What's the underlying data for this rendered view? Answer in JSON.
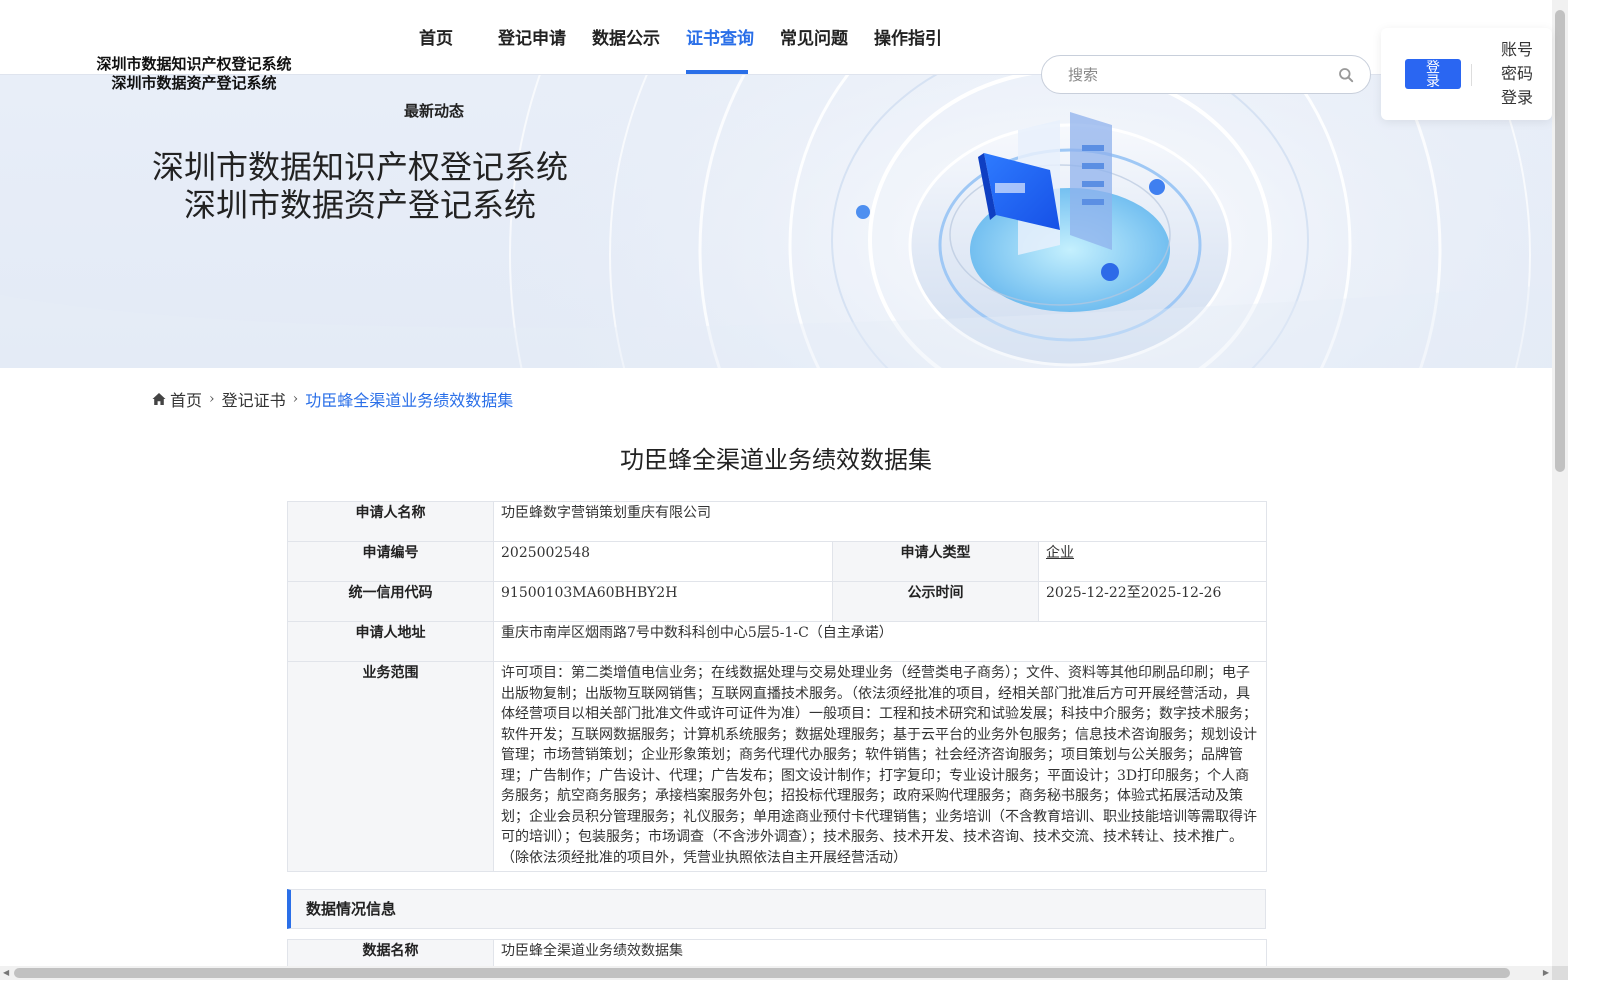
{
  "header": {
    "logo_line1": "深圳市数据知识产权登记系统",
    "logo_line2": "深圳市数据资产登记系统",
    "nav": [
      {
        "label": "首页"
      },
      {
        "label": "登记申请"
      },
      {
        "label": "数据公示"
      },
      {
        "label": "证书查询"
      },
      {
        "label": "常见问题"
      },
      {
        "label": "操作指引"
      }
    ],
    "nav_active": "证书查询",
    "nav_sub": "最新动态",
    "search_placeholder": "搜索",
    "login_label": "登录",
    "password_login_label": "账号密码登录",
    "accent_color": "#2a6fe8"
  },
  "banner": {
    "title_line1": "深圳市数据知识产权登记系统",
    "title_line2": "深圳市数据资产登记系统"
  },
  "breadcrumb": {
    "home": "首页",
    "level1": "登记证书",
    "current": "功臣蜂全渠道业务绩效数据集"
  },
  "page_title": "功臣蜂全渠道业务绩效数据集",
  "info": {
    "applicant_name_label": "申请人名称",
    "applicant_name": "功臣蜂数字营销策划重庆有限公司",
    "app_no_label": "申请编号",
    "app_no": "2025002548",
    "applicant_type_label": "申请人类型",
    "applicant_type": "企业",
    "credit_code_label": "统一信用代码",
    "credit_code": "91500103MA60BHBY2H",
    "publicity_label": "公示时间",
    "publicity": "2025-12-22至2025-12-26",
    "address_label": "申请人地址",
    "address": "重庆市南岸区烟雨路7号中数科科创中心5层5-1-C（自主承诺）",
    "scope_label": "业务范围",
    "scope": "许可项目：第二类增值电信业务；在线数据处理与交易处理业务（经营类电子商务）；文件、资料等其他印刷品印刷；电子出版物复制；出版物互联网销售；互联网直播技术服务。（依法须经批准的项目，经相关部门批准后方可开展经营活动，具体经营项目以相关部门批准文件或许可证件为准）一般项目：工程和技术研究和试验发展；科技中介服务；数字技术服务；软件开发；互联网数据服务；计算机系统服务；数据处理服务；基于云平台的业务外包服务；信息技术咨询服务；规划设计管理；市场营销策划；企业形象策划；商务代理代办服务；软件销售；社会经济咨询服务；项目策划与公关服务；品牌管理；广告制作；广告设计、代理；广告发布；图文设计制作；打字复印；专业设计服务；平面设计；3D打印服务；个人商务服务；航空商务服务；承接档案服务外包；招投标代理服务；政府采购代理服务；商务秘书服务；体验式拓展活动及策划；企业会员积分管理服务；礼仪服务；单用途商业预付卡代理销售；业务培训（不含教育培训、职业技能培训等需取得许可的培训）；包装服务；市场调查（不含涉外调查）；技术服务、技术开发、技术咨询、技术交流、技术转让、技术推广。（除依法须经批准的项目外，凭营业执照依法自主开展经营活动）"
  },
  "data_section": {
    "title": "数据情况信息",
    "data_name_label": "数据名称",
    "data_name": "功臣蜂全渠道业务绩效数据集"
  }
}
